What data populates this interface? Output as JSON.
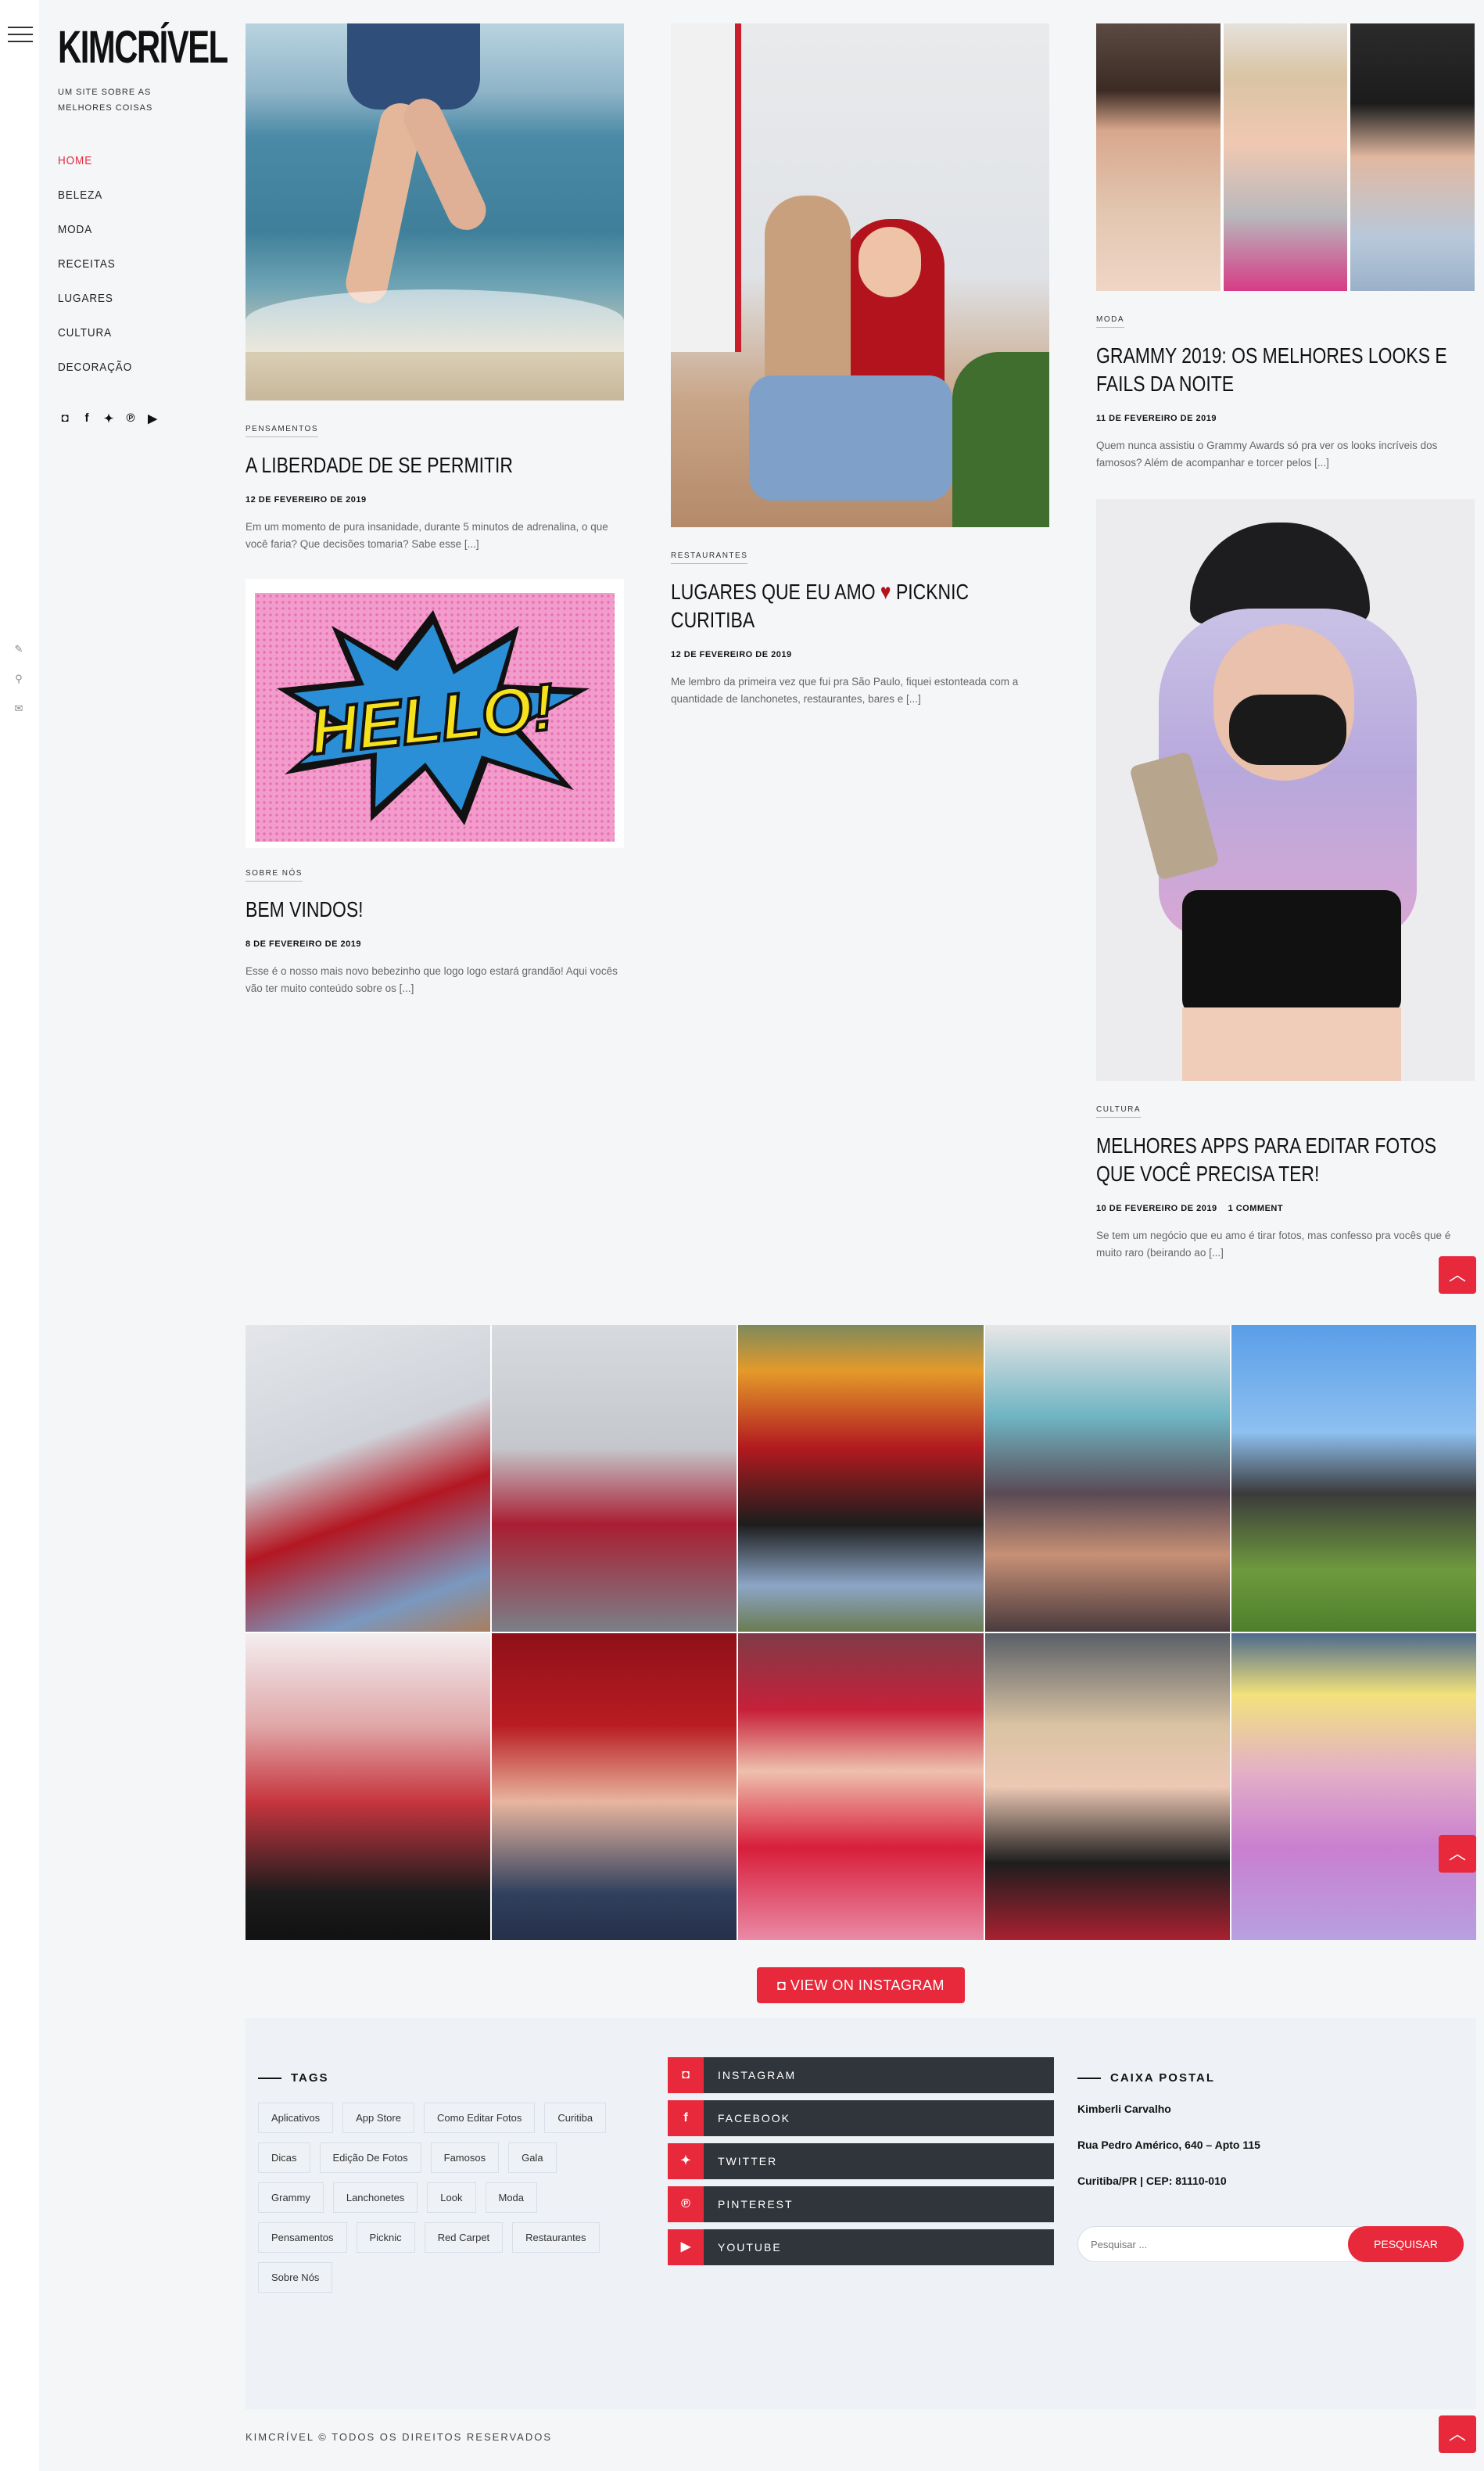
{
  "site": {
    "logo": "KIMCRÍVEL",
    "tagline": "UM SITE SOBRE AS MELHORES COISAS"
  },
  "nav": [
    "HOME",
    "BELEZA",
    "MODA",
    "RECEITAS",
    "LUGARES",
    "CULTURA",
    "DECORAÇÃO"
  ],
  "posts": [
    {
      "category": "PENSAMENTOS",
      "title": "A LIBERDADE DE SE PERMITIR",
      "date": "12 DE FEVEREIRO DE 2019",
      "excerpt": "Em um momento de pura insanidade, durante 5 minutos de adrenalina, o que você faria? Que decisões tomaria? Sabe esse [...]"
    },
    {
      "category": "SOBRE NÓS",
      "title": "BEM VINDOS!",
      "date": "8 DE FEVEREIRO DE 2019",
      "excerpt": "Esse é o nosso mais novo bebezinho que logo logo estará grandão! Aqui vocês vão ter muito conteúdo sobre os [...]",
      "image_text": "HELLO!"
    },
    {
      "category": "RESTAURANTES",
      "title_before": "LUGARES QUE EU AMO",
      "title_after": "PICKNIC CURITIBA",
      "date": "12 DE FEVEREIRO DE 2019",
      "excerpt": "Me lembro da primeira vez que fui pra São Paulo, fiquei estonteada com a quantidade de lanchonetes, restaurantes, bares e [...]"
    },
    {
      "category": "MODA",
      "title": "GRAMMY 2019: OS MELHORES LOOKS E FAILS DA NOITE",
      "date": "11 DE FEVEREIRO DE 2019",
      "excerpt": "Quem nunca assistiu o Grammy Awards só pra ver os looks incríveis dos famosos? Além de acompanhar e torcer pelos [...]"
    },
    {
      "category": "CULTURA",
      "title": "MELHORES APPS PARA EDITAR FOTOS QUE VOCÊ PRECISA TER!",
      "date": "10 DE FEVEREIRO DE 2019",
      "comments": "1 COMMENT",
      "excerpt": "Se tem um negócio que eu amo é tirar fotos, mas confesso pra vocês que é muito raro (beirando ao [...]"
    }
  ],
  "instagram": {
    "button_label": "VIEW ON INSTAGRAM"
  },
  "footer": {
    "tags_title": "TAGS",
    "tags": [
      "Aplicativos",
      "App Store",
      "Como Editar Fotos",
      "Curitiba",
      "Dicas",
      "Edição De Fotos",
      "Famosos",
      "Gala",
      "Grammy",
      "Lanchonetes",
      "Look",
      "Moda",
      "Pensamentos",
      "Picknic",
      "Red Carpet",
      "Restaurantes",
      "Sobre Nós"
    ],
    "social": [
      "INSTAGRAM",
      "FACEBOOK",
      "TWITTER",
      "PINTEREST",
      "YOUTUBE"
    ],
    "mail_title": "CAIXA POSTAL",
    "name": "Kimberli Carvalho",
    "street": "Rua Pedro Américo, 640 – Apto 115",
    "city": "Curitiba/PR  | CEP: 81110-010",
    "search_placeholder": "Pesquisar ...",
    "search_button": "PESQUISAR"
  },
  "copyright": "KIMCRÍVEL © TODOS OS DIREITOS RESERVADOS",
  "colors": {
    "accent": "#e8293b",
    "dark_bar": "#30353b",
    "background": "#f4f6f8"
  }
}
